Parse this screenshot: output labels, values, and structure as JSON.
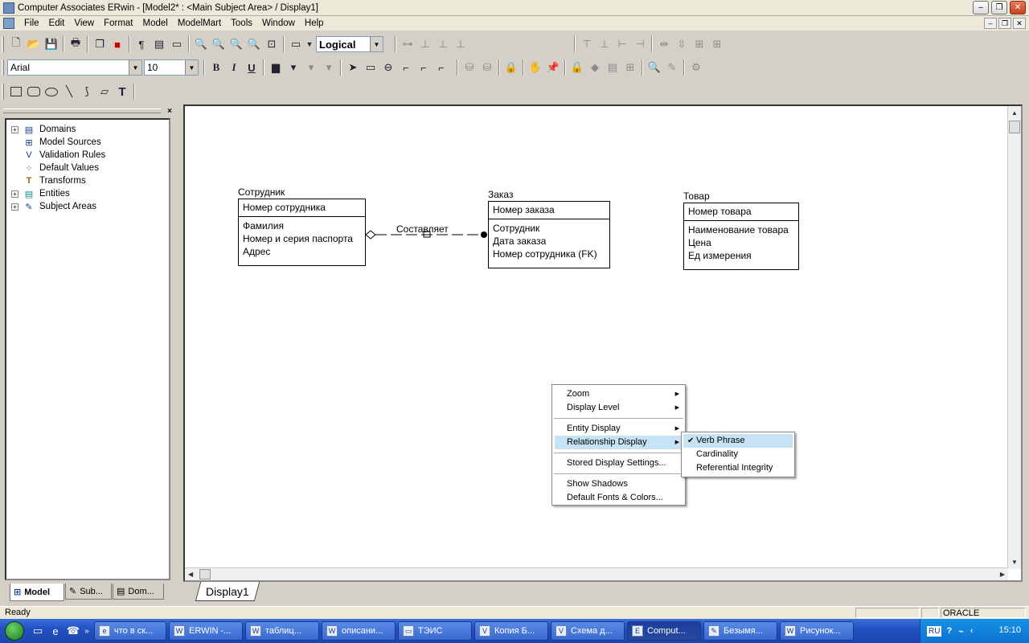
{
  "window": {
    "title": "Computer Associates ERwin - [Model2* : <Main Subject Area> / Display1]",
    "min_glyph": "–",
    "max_glyph": "❐",
    "close_glyph": "✕"
  },
  "menubar": [
    "File",
    "Edit",
    "View",
    "Format",
    "Model",
    "ModelMart",
    "Tools",
    "Window",
    "Help"
  ],
  "toolbar": {
    "model_level": "Logical",
    "font_name": "Arial",
    "font_size": "10",
    "bold": "B",
    "italic": "I",
    "underline": "U",
    "text_tool": "T"
  },
  "left_panel": {
    "close_glyph": "×",
    "tree": [
      {
        "label": "Domains",
        "expandable": true,
        "icon": "domains-icon"
      },
      {
        "label": "Model Sources",
        "expandable": false,
        "icon": "model-sources-icon"
      },
      {
        "label": "Validation Rules",
        "expandable": false,
        "icon": "validation-rules-icon"
      },
      {
        "label": "Default Values",
        "expandable": false,
        "icon": "default-values-icon"
      },
      {
        "label": "Transforms",
        "expandable": false,
        "icon": "transforms-icon"
      },
      {
        "label": "Entities",
        "expandable": true,
        "icon": "entities-icon"
      },
      {
        "label": "Subject Areas",
        "expandable": true,
        "icon": "subject-areas-icon"
      }
    ],
    "tabs": [
      "Model",
      "Sub...",
      "Dom..."
    ]
  },
  "diagram": {
    "entities": [
      {
        "name": "Сотрудник",
        "pk": [
          "Номер сотрудника"
        ],
        "attrs": [
          "Фамилия",
          "Номер и серия паспорта",
          "Адрес"
        ]
      },
      {
        "name": "Заказ",
        "pk": [
          "Номер заказа"
        ],
        "attrs": [
          "Сотрудник",
          "Дата заказа",
          "Номер сотрудника (FK)"
        ]
      },
      {
        "name": "Товар",
        "pk": [
          "Номер товара"
        ],
        "attrs": [
          "Наименование товара",
          "Цена",
          "Ед измерения"
        ]
      }
    ],
    "relationship": {
      "verb": "Составляет"
    }
  },
  "context_menu": {
    "items": [
      {
        "label": "Zoom",
        "submenu": true
      },
      {
        "label": "Display Level",
        "submenu": true
      },
      {
        "sep": true
      },
      {
        "label": "Entity Display",
        "submenu": true
      },
      {
        "label": "Relationship Display",
        "submenu": true,
        "highlighted": true
      },
      {
        "sep": true
      },
      {
        "label": "Stored Display Settings...",
        "submenu": false
      },
      {
        "sep": true
      },
      {
        "label": "Show Shadows",
        "submenu": false
      },
      {
        "label": "Default Fonts & Colors...",
        "submenu": false
      }
    ],
    "submenu": [
      {
        "label": "Verb Phrase",
        "checked": true,
        "highlighted": true
      },
      {
        "label": "Cardinality",
        "checked": false
      },
      {
        "label": "Referential Integrity",
        "checked": false
      }
    ]
  },
  "sheet_tab": "Display1",
  "statusbar": {
    "text": "Ready",
    "db": "ORACLE"
  },
  "taskbar": {
    "buttons": [
      "что в ск...",
      "ERWIN -...",
      "таблиц...",
      "описани...",
      "ТЭИС",
      "Копия Б...",
      "Схема д...",
      "Comput...",
      "Безымя...",
      "Рисунок..."
    ],
    "lang": "RU",
    "clock": "15:10"
  }
}
